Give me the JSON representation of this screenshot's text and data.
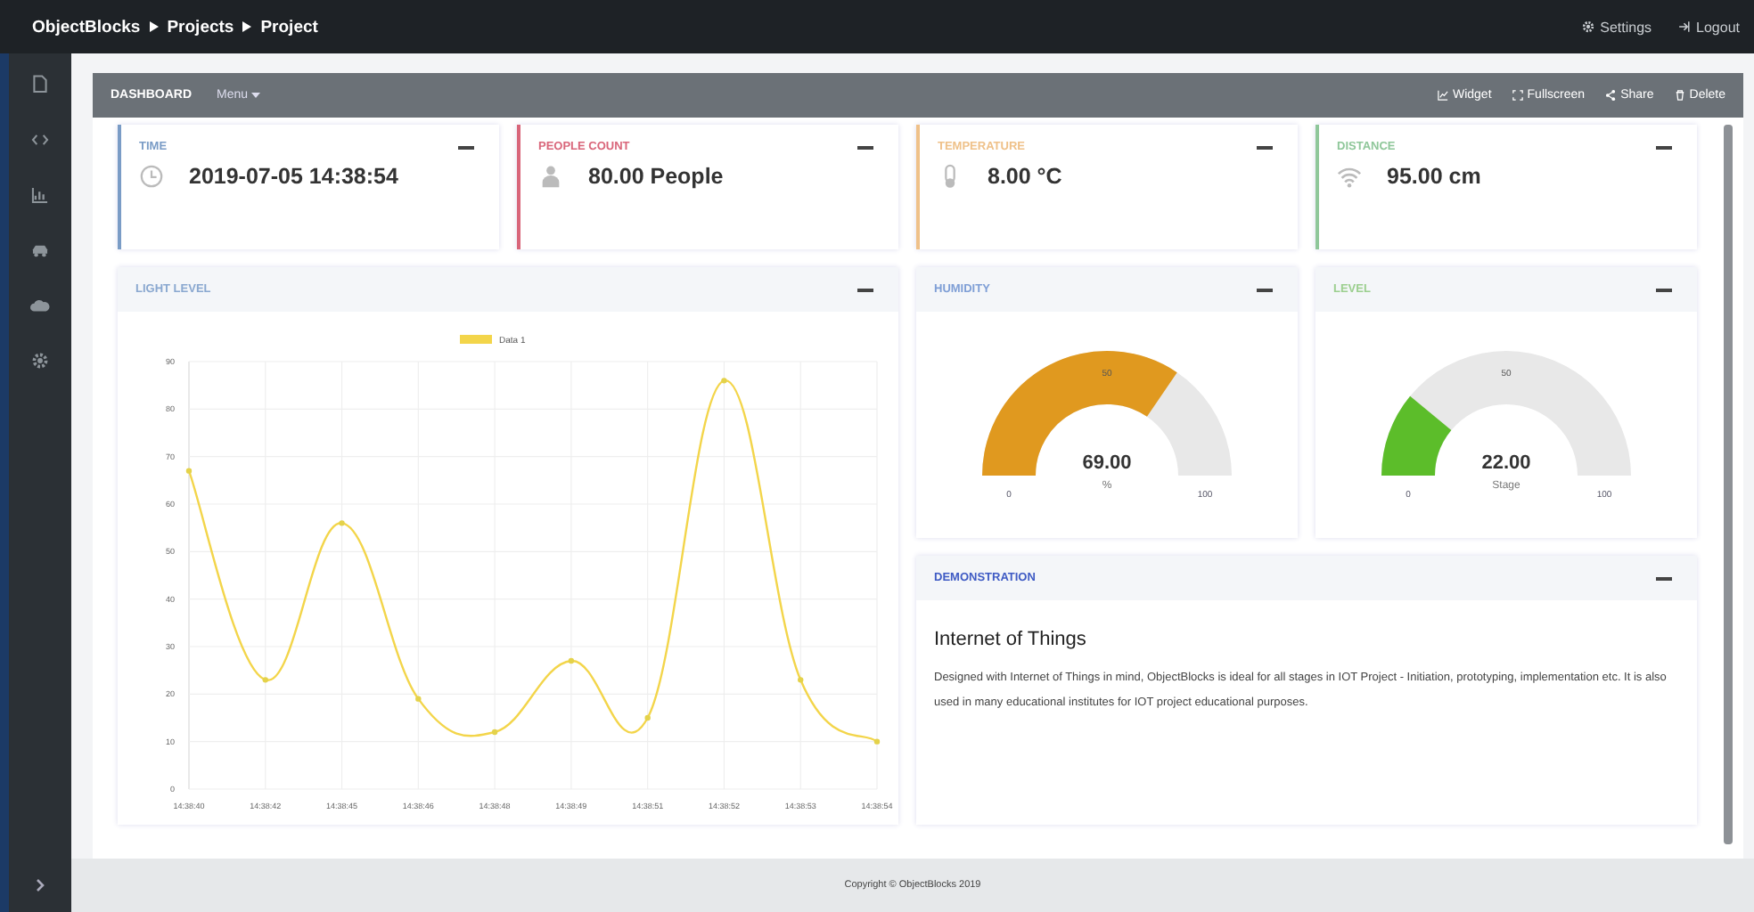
{
  "topbar": {
    "breadcrumb": [
      "ObjectBlocks",
      "Projects",
      "Project"
    ],
    "links": [
      {
        "kind": "settings",
        "label": "Settings"
      },
      {
        "kind": "logout",
        "label": "Logout"
      }
    ]
  },
  "sidebar": {
    "items": [
      {
        "kind": "file"
      },
      {
        "kind": "code"
      },
      {
        "kind": "chart"
      },
      {
        "kind": "car"
      },
      {
        "kind": "cloud"
      },
      {
        "kind": "gear"
      }
    ]
  },
  "dashboard": {
    "title": "DASHBOARD",
    "menu": "Menu",
    "actions": [
      {
        "kind": "widget",
        "label": "Widget"
      },
      {
        "kind": "fullscreen",
        "label": "Fullscreen"
      },
      {
        "kind": "share",
        "label": "Share"
      },
      {
        "kind": "delete",
        "label": "Delete"
      }
    ]
  },
  "stats": [
    {
      "kind": "clock",
      "title": "TIME",
      "color": "#7a9cc6",
      "value": "2019-07-05 14:38:54"
    },
    {
      "kind": "person",
      "title": "PEOPLE COUNT",
      "color": "#d9667a",
      "value": "80.00 People"
    },
    {
      "kind": "thermometer",
      "title": "TEMPERATURE",
      "color": "#efc189",
      "value": "8.00 °C"
    },
    {
      "kind": "wifi",
      "title": "DISTANCE",
      "color": "#8fc79a",
      "value": "95.00 cm"
    }
  ],
  "light_panel": {
    "title": "LIGHT LEVEL",
    "color": "#8aa8d0",
    "chart_data": {
      "type": "line",
      "categories": [
        "14:38:40",
        "14:38:42",
        "14:38:45",
        "14:38:46",
        "14:38:48",
        "14:38:49",
        "14:38:51",
        "14:38:52",
        "14:38:53",
        "14:38:54"
      ],
      "grid": true,
      "series": [
        {
          "name": "Data 1",
          "color": "#f3d54a",
          "marker": "circle",
          "values": [
            67,
            23,
            56,
            19,
            12,
            27,
            15,
            86,
            23,
            10
          ]
        }
      ],
      "ylim": [
        0,
        90
      ],
      "yticks": [
        0,
        10,
        20,
        30,
        40,
        50,
        60,
        70,
        80,
        90
      ]
    }
  },
  "gauges": [
    {
      "title": "HUMIDITY",
      "color": "#7f9fd6",
      "gauge": {
        "color": "#e0991f",
        "value": "69.00",
        "unit": "%",
        "min": "0",
        "mid": "50",
        "max": "100"
      }
    },
    {
      "title": "LEVEL",
      "color": "#9ccf8f",
      "gauge": {
        "color": "#5cbd2a",
        "value": "22.00",
        "unit": "Stage",
        "min": "0",
        "mid": "50",
        "max": "100"
      }
    }
  ],
  "demo": {
    "title": "DEMONSTRATION",
    "color": "#3f5bc4",
    "heading": "Internet of Things",
    "text": "Designed with Internet of Things in mind, ObjectBlocks is ideal for all stages in IOT Project - Initiation, prototyping, implementation etc. It is also used in many educational institutes for IOT project educational purposes."
  },
  "footer": "Copyright © ObjectBlocks 2019"
}
